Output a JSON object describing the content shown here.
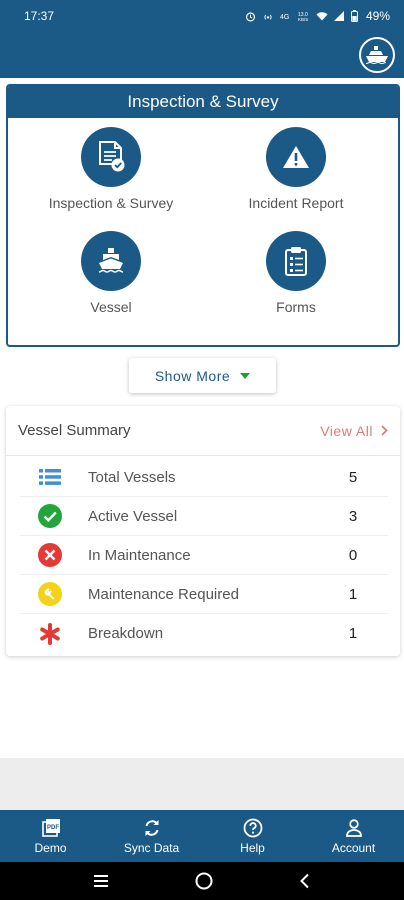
{
  "status_bar": {
    "time": "17:37",
    "battery": "49%",
    "icons": [
      "alarm-icon",
      "hotspot-icon",
      "volte-icon",
      "data-speed-icon",
      "wifi-icon",
      "signal-icon",
      "battery-icon"
    ]
  },
  "app_bar": {
    "action_icon": "ship-icon"
  },
  "inspection_card": {
    "title": "Inspection & Survey",
    "items": [
      {
        "label": "Inspection & Survey",
        "icon": "document-check-icon"
      },
      {
        "label": "Incident Report",
        "icon": "warning-icon"
      },
      {
        "label": "Vessel",
        "icon": "vessel-icon"
      },
      {
        "label": "Forms",
        "icon": "clipboard-icon"
      }
    ]
  },
  "show_more": {
    "label": "Show More",
    "icon": "caret-down-icon",
    "icon_color": "#1e9e3a"
  },
  "vessel_summary": {
    "title": "Vessel Summary",
    "view_all": "View All",
    "rows": [
      {
        "label": "Total Vessels",
        "count": "5",
        "icon": "list-icon",
        "color": "#3f8fd9"
      },
      {
        "label": "Active Vessel",
        "count": "3",
        "icon": "check-circle-icon",
        "color": "#23a53c"
      },
      {
        "label": "In Maintenance",
        "count": "0",
        "icon": "close-circle-icon",
        "color": "#e53935"
      },
      {
        "label": "Maintenance Required",
        "count": "1",
        "icon": "wrench-circle-icon",
        "color": "#f4d21a"
      },
      {
        "label": "Breakdown",
        "count": "1",
        "icon": "asterisk-icon",
        "color": "#e53935"
      }
    ]
  },
  "bottom_nav": {
    "items": [
      {
        "label": "Demo",
        "icon": "pdf-icon"
      },
      {
        "label": "Sync Data",
        "icon": "sync-icon"
      },
      {
        "label": "Help",
        "icon": "help-icon"
      },
      {
        "label": "Account",
        "icon": "account-icon"
      }
    ]
  },
  "system_nav": {
    "icons": [
      "recents-icon",
      "home-icon",
      "back-icon"
    ]
  },
  "colors": {
    "primary": "#1b5a86",
    "view_all": "#e07a7a"
  }
}
